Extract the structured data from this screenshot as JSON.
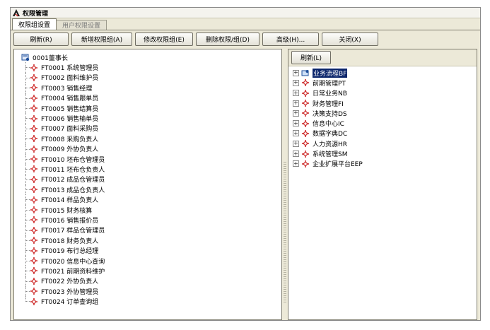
{
  "window": {
    "title": "权限管理",
    "colors": {
      "accent_red": "#cc2222",
      "selection": "#0a246a",
      "panel": "#ece9d8"
    }
  },
  "tabs": [
    {
      "label": "权限组设置",
      "active": true
    },
    {
      "label": "用户权限设置",
      "active": false
    }
  ],
  "toolbar": {
    "refresh": "刷新(R)",
    "add": "新增权限组(A)",
    "edit": "修改权限组(E)",
    "delete": "删除权限/组(D)",
    "advanced": "高级(H)...",
    "close": "关闭(X)"
  },
  "left_tree": {
    "root": {
      "label": "0001董事长",
      "icon": "group-icon"
    },
    "items": [
      {
        "label": "FT0001 系统管理员"
      },
      {
        "label": "FT0002 面料维护员"
      },
      {
        "label": "FT0003 销售经理"
      },
      {
        "label": "FT0004 销售跟单员"
      },
      {
        "label": "FT0005 销售结算员"
      },
      {
        "label": "FT0006 销售输单员"
      },
      {
        "label": "FT0007 面料采购员"
      },
      {
        "label": "FT0008 采购负责人"
      },
      {
        "label": "FT0009 外协负责人"
      },
      {
        "label": "FT0010 坯布仓管理员"
      },
      {
        "label": "FT0011 坯布仓负责人"
      },
      {
        "label": "FT0012 成品仓管理员"
      },
      {
        "label": "FT0013 成品仓负责人"
      },
      {
        "label": "FT0014 样品负责人"
      },
      {
        "label": "FT0015 财务核算"
      },
      {
        "label": "FT0016 销售报价员"
      },
      {
        "label": "FT0017 样品仓管理员"
      },
      {
        "label": "FT0018 财务负责人"
      },
      {
        "label": "FT0019 布行总经理"
      },
      {
        "label": "FT0020 信息中心查询"
      },
      {
        "label": "FT0021 前期资料维护"
      },
      {
        "label": "FT0022 外协负责人"
      },
      {
        "label": "FT0023 外协管理员"
      },
      {
        "label": "FT0024 订单查询组"
      }
    ]
  },
  "right_panel": {
    "refresh": "刷新(L)",
    "items": [
      {
        "label": "业务流程BF",
        "selected": true,
        "icon": "folder-user-icon"
      },
      {
        "label": "前期管理PT"
      },
      {
        "label": "日常业务NB"
      },
      {
        "label": "财务管理FI"
      },
      {
        "label": "决策支持DS"
      },
      {
        "label": "信息中心IC"
      },
      {
        "label": "数据字典DC"
      },
      {
        "label": "人力资源HR"
      },
      {
        "label": "系统管理SM"
      },
      {
        "label": "企业扩展平台EEP"
      }
    ]
  }
}
